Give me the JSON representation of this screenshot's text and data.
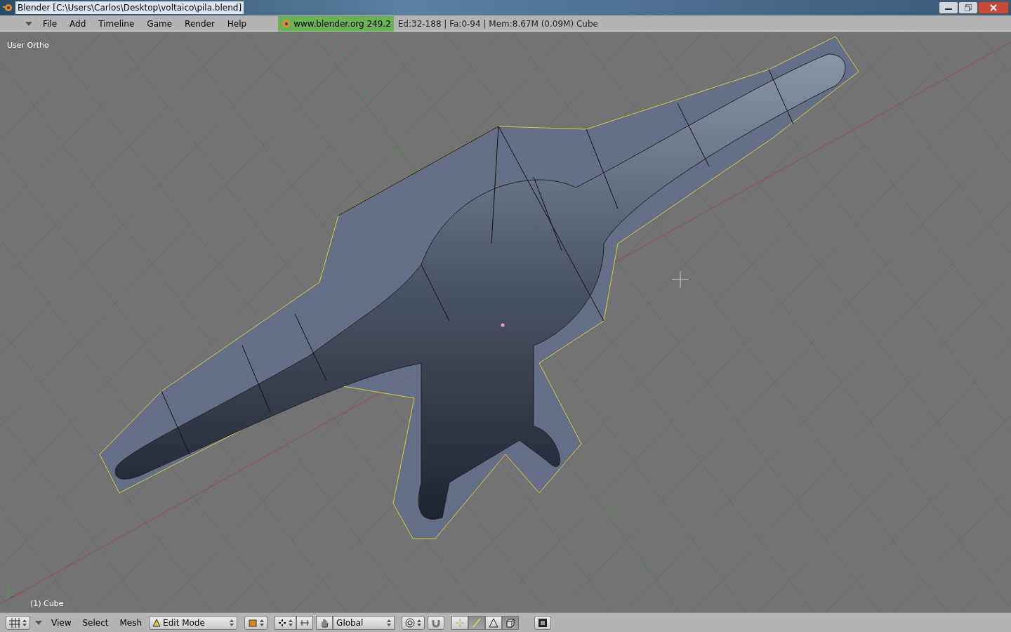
{
  "window": {
    "title": "Blender [C:\\Users\\Carlos\\Desktop\\voltaico\\pila.blend]"
  },
  "menu": [
    "File",
    "Add",
    "Timeline",
    "Game",
    "Render",
    "Help"
  ],
  "info": {
    "version": "www.blender.org 249.2",
    "stats": "Ed:32-188 | Fa:0-94 | Mem:8.67M (0.09M) Cube"
  },
  "viewport": {
    "label": "User Ortho",
    "object": "(1) Cube"
  },
  "header": {
    "menus": [
      "View",
      "Select",
      "Mesh"
    ],
    "mode": "Edit Mode",
    "orientation": "Global",
    "select_modes": [
      {
        "kind": "vertex",
        "selected": false
      },
      {
        "kind": "edge",
        "selected": true
      },
      {
        "kind": "face",
        "selected": false
      }
    ],
    "occlude": true
  }
}
